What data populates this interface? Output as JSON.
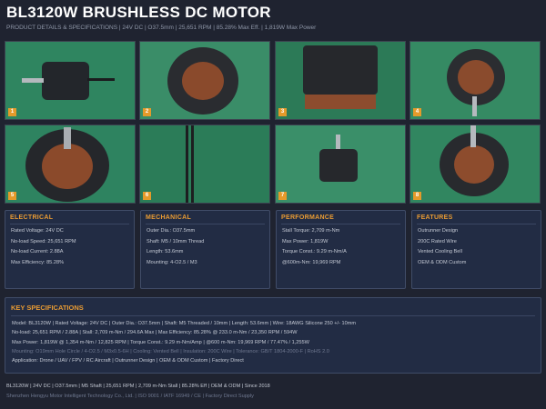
{
  "header": {
    "title": "BL3120W BRUSHLESS DC MOTOR",
    "subtitle": "PRODUCT DETAILS & SPECIFICATIONS  |  24V DC  |  O37.5mm  |  25,651 RPM  |  85.28% Max Eff.  |  1,819W Max Power"
  },
  "photos": [
    {
      "number": "1"
    },
    {
      "number": "2"
    },
    {
      "number": "3"
    },
    {
      "number": "4"
    },
    {
      "number": "5"
    },
    {
      "number": "6"
    },
    {
      "number": "7"
    },
    {
      "number": "8"
    }
  ],
  "cards": [
    {
      "title": "ELECTRICAL",
      "lines": [
        "Rated Voltage: 24V DC",
        "No-load Speed: 25,651 RPM",
        "No-load Current: 2.88A",
        "Max Efficiency: 85.28%"
      ]
    },
    {
      "title": "MECHANICAL",
      "lines": [
        "Outer Dia.: O37.5mm",
        "Shaft: M5 / 10mm Thread",
        "Length: 53.6mm",
        "Mounting: 4-O2.5 / M3"
      ]
    },
    {
      "title": "PERFORMANCE",
      "lines": [
        "Stall Torque: 2,709 m-Nm",
        "Max Power: 1,819W",
        "Torque Const.: 9.29 m-Nm/A",
        "@600m-Nm: 19,969 RPM"
      ]
    },
    {
      "title": "FEATURES",
      "lines": [
        "Outrunner Design",
        "200C Rated Wire",
        "Vented Cooling Bell",
        "OEM & ODM Custom"
      ]
    }
  ],
  "specs": {
    "title": "KEY SPECIFICATIONS",
    "lines": [
      "Model: BL3120W  |  Rated Voltage: 24V DC  |  Outer Dia.: O37.5mm  |  Shaft: M5 Threaded / 10mm  |  Length: 53.6mm  |  Wire: 18AWG Silicone 250 +/- 10mm",
      "No-load: 25,651 RPM / 2.88A  |  Stall: 2,709 m-Nm / 294.6A Max  |  Max Efficiency: 85.28% @ 233.0 m-Nm / 23,350 RPM / 594W",
      "Max Power: 1,819W @ 1,354 m-Nm / 12,825 RPM  |  Torque Const.: 9.29 m-Nm/Amp  |  @600 m-Nm: 19,969 RPM / 77.47% / 1,255W",
      "Mounting: O19mm Hole Circle / 4-O2.5 / M3x0.5-6H  |  Cooling: Vented Bell  |  Insulation: 200C Wire  |  Tolerance: GB/T 1804-2000-F  |  RoHS 2.0",
      "Application: Drone / UAV / FPV / RC Aircraft  |  Outrunner Design  |  OEM & ODM Custom  |  Factory Direct"
    ]
  },
  "footer": {
    "line1": "BL3120W  |  24V DC  |  O37.5mm  |  M5 Shaft  |  25,651 RPM  |  2,709 m-Nm Stall  |  85.28% Eff  |  OEM & ODM  |  Since 2018",
    "line2": "Shenzhen Hengyu Motor Intelligent Technology Co., Ltd.  |  ISO 9001 / IATF 16949 / CE  |  Factory Direct Supply"
  },
  "colors": {
    "background": "#1f2330",
    "panel": "#222c44",
    "accent": "#e89b33",
    "badge": "#e59a2a",
    "photo_bg": "#2d7c5a"
  }
}
